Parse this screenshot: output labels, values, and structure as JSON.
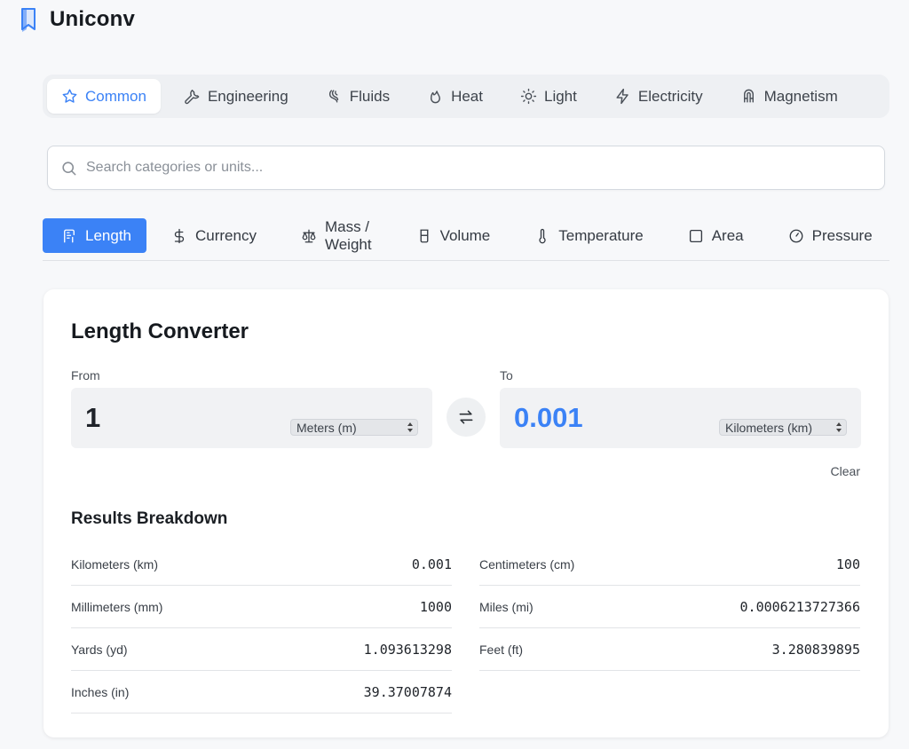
{
  "app": {
    "title": "Uniconv"
  },
  "groups": [
    {
      "label": "Common",
      "icon": "star-icon",
      "active": true
    },
    {
      "label": "Engineering",
      "icon": "wrench-icon",
      "active": false
    },
    {
      "label": "Fluids",
      "icon": "droplet-icon",
      "active": false
    },
    {
      "label": "Heat",
      "icon": "flame-icon",
      "active": false
    },
    {
      "label": "Light",
      "icon": "sun-icon",
      "active": false
    },
    {
      "label": "Electricity",
      "icon": "bolt-icon",
      "active": false
    },
    {
      "label": "Magnetism",
      "icon": "magnet-icon",
      "active": false
    }
  ],
  "search": {
    "placeholder": "Search categories or units..."
  },
  "categories": [
    {
      "label": "Length",
      "icon": "ruler-icon",
      "active": true
    },
    {
      "label": "Currency",
      "icon": "dollar-icon",
      "active": false
    },
    {
      "label": "Mass / Weight",
      "icon": "scale-icon",
      "active": false
    },
    {
      "label": "Volume",
      "icon": "beaker-icon",
      "active": false
    },
    {
      "label": "Temperature",
      "icon": "thermometer-icon",
      "active": false
    },
    {
      "label": "Area",
      "icon": "square-icon",
      "active": false
    },
    {
      "label": "Pressure",
      "icon": "gauge-icon",
      "active": false
    }
  ],
  "converter": {
    "title": "Length Converter",
    "from_label": "From",
    "to_label": "To",
    "from_value": "1",
    "from_unit": "Meters (m)",
    "to_value": "0.001",
    "to_unit": "Kilometers (km)",
    "clear_label": "Clear",
    "breakdown_title": "Results Breakdown",
    "results": [
      {
        "unit": "Kilometers (km)",
        "value": "0.001"
      },
      {
        "unit": "Centimeters (cm)",
        "value": "100"
      },
      {
        "unit": "Millimeters (mm)",
        "value": "1000"
      },
      {
        "unit": "Miles (mi)",
        "value": "0.0006213727366"
      },
      {
        "unit": "Yards (yd)",
        "value": "1.093613298"
      },
      {
        "unit": "Feet (ft)",
        "value": "3.280839895"
      },
      {
        "unit": "Inches (in)",
        "value": "39.37007874"
      }
    ]
  },
  "colors": {
    "accent": "#3b82f6",
    "background": "#f7f8fa",
    "card": "#ffffff"
  }
}
